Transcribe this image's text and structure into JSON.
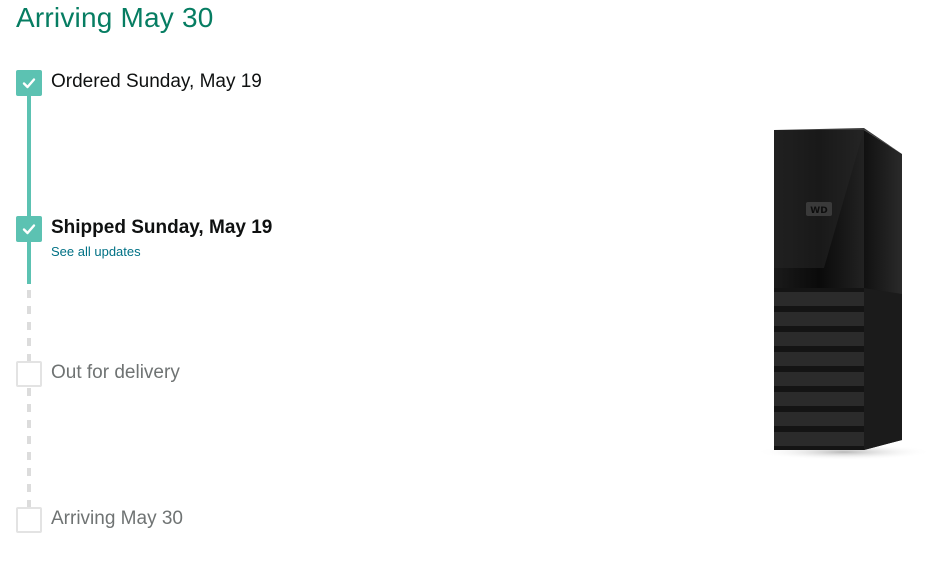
{
  "header": {
    "title": "Arriving May 30"
  },
  "steps": [
    {
      "label": "Ordered Sunday, May 19",
      "status": "complete"
    },
    {
      "label": "Shipped Sunday, May 19",
      "status": "complete",
      "link": "See all updates"
    },
    {
      "label": "Out for delivery",
      "status": "pending"
    },
    {
      "label": "Arriving May 30",
      "status": "pending"
    }
  ],
  "product": {
    "icon": "external-hard-drive-image",
    "brand_mark": "WD"
  },
  "colors": {
    "accent": "#067d62",
    "progress": "#5cc2b2",
    "link": "#007185",
    "muted": "#6f7373"
  }
}
